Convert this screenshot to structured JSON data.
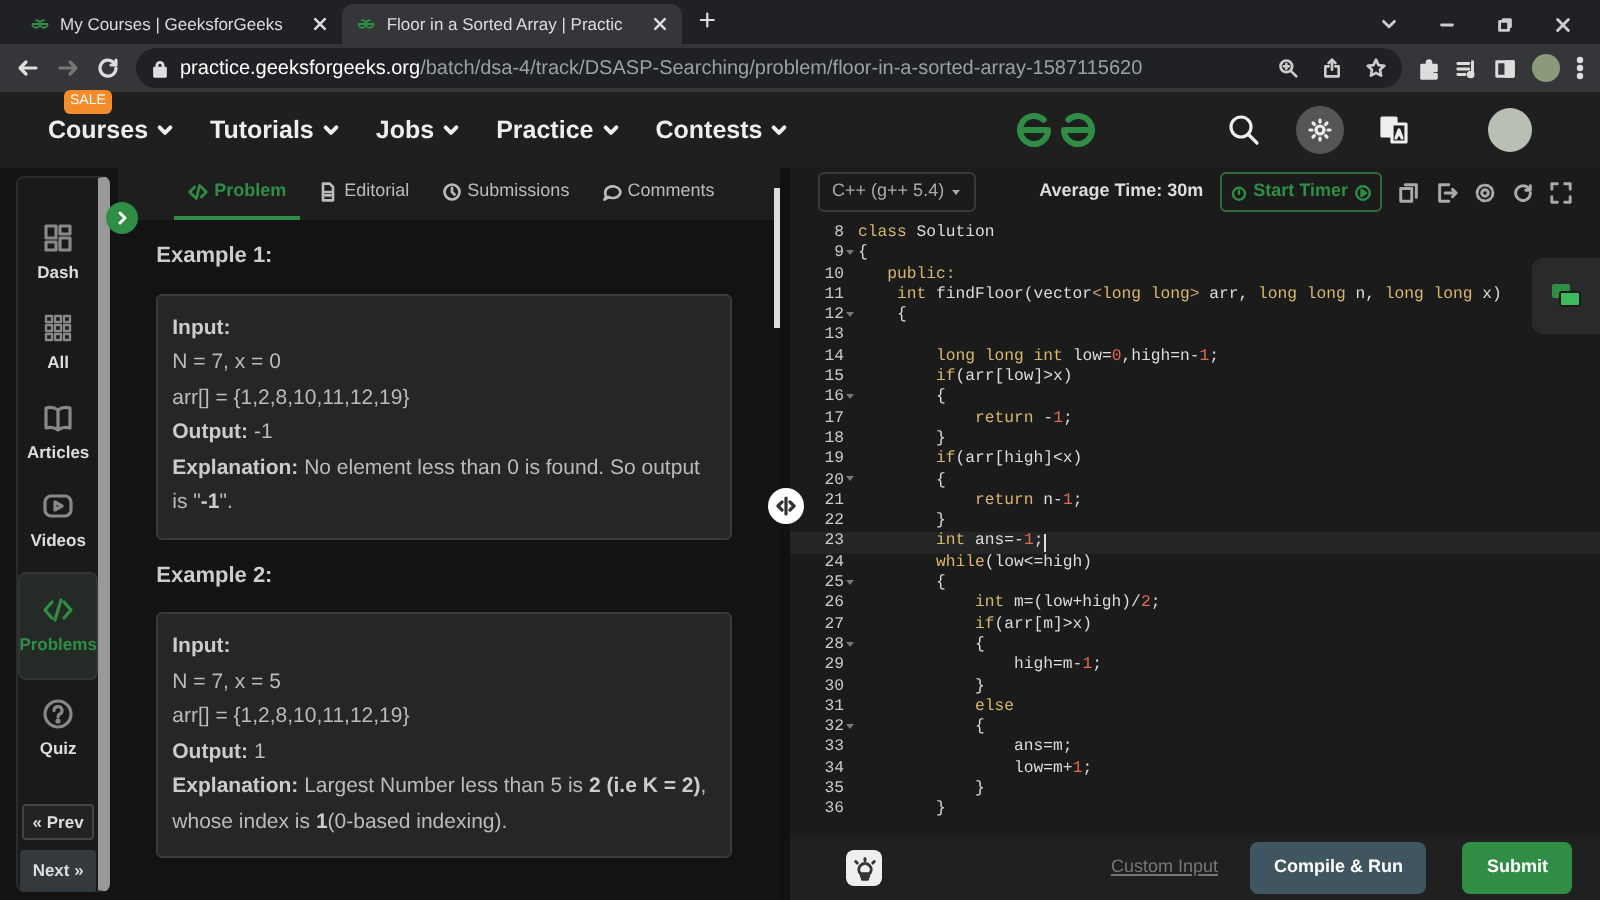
{
  "browser": {
    "tabs": [
      {
        "title": "My Courses | GeeksforGeeks",
        "selected": false
      },
      {
        "title": "Floor in a Sorted Array | Practic",
        "selected": true
      }
    ],
    "new_tab": "+",
    "forward_disabled": true,
    "address": {
      "host": "practice.geeksforgeeks.org",
      "path": "/batch/dsa-4/track/DSASP-Searching/problem/floor-in-a-sorted-array-1587115620"
    }
  },
  "site_nav": {
    "items": [
      {
        "label": "Courses",
        "badge": "SALE"
      },
      {
        "label": "Tutorials"
      },
      {
        "label": "Jobs"
      },
      {
        "label": "Practice"
      },
      {
        "label": "Contests"
      }
    ]
  },
  "sidebar": {
    "items": [
      {
        "label": "Dash",
        "kind": "dash",
        "selected": false
      },
      {
        "label": "All",
        "kind": "all",
        "selected": false
      },
      {
        "label": "Articles",
        "kind": "articles",
        "selected": false
      },
      {
        "label": "Videos",
        "kind": "videos",
        "selected": false
      },
      {
        "label": "Problems",
        "kind": "problems",
        "selected": true
      },
      {
        "label": "Quiz",
        "kind": "quiz",
        "selected": false
      }
    ],
    "prev": "« Prev",
    "next": "Next »"
  },
  "problem_tabs": [
    {
      "label": "Problem",
      "kind": "code",
      "selected": true
    },
    {
      "label": "Editorial",
      "kind": "doc",
      "selected": false
    },
    {
      "label": "Submissions",
      "kind": "clock",
      "selected": false
    },
    {
      "label": "Comments",
      "kind": "chat",
      "selected": false
    }
  ],
  "examples": [
    {
      "title": "Example 1:",
      "input_label": "Input:",
      "input_lines": [
        "N = 7, x = 0",
        "arr[] = {1,2,8,10,11,12,19}"
      ],
      "output_label": "Output:",
      "output": "-1",
      "explanation_label": "Explanation:",
      "explanation": "No element less than 0 is found. So output is \"**-1**\"."
    },
    {
      "title": "Example 2:",
      "input_label": "Input:",
      "input_lines": [
        "N = 7, x = 5",
        "arr[] = {1,2,8,10,11,12,19}"
      ],
      "output_label": "Output:",
      "output": "1",
      "explanation_label": "Explanation:",
      "explanation": "Largest Number less than 5 is **2 (i.e K = 2)**, whose index is **1**(0-based indexing)."
    }
  ],
  "editor": {
    "language": "C++ (g++ 5.4)",
    "average_time": "Average Time: 30m",
    "timer_button": "Start Timer",
    "lines": [
      {
        "no": "8",
        "code": [
          {
            "kind": "keyword",
            "text": "class"
          },
          {
            "kind": "plain",
            "text": " Solution"
          }
        ]
      },
      {
        "no": "9",
        "fold": true,
        "code": [
          {
            "kind": "plain",
            "text": "{"
          }
        ]
      },
      {
        "no": "10",
        "code": [
          {
            "kind": "keyword",
            "text": "   public:"
          }
        ]
      },
      {
        "no": "11",
        "code": [
          {
            "kind": "keyword",
            "text": "    int"
          },
          {
            "kind": "plain",
            "text": " findFloor(vector"
          },
          {
            "kind": "operator",
            "text": "<"
          },
          {
            "kind": "keyword",
            "text": "long long"
          },
          {
            "kind": "operator",
            "text": ">"
          },
          {
            "kind": "plain",
            "text": " arr, "
          },
          {
            "kind": "keyword",
            "text": "long long"
          },
          {
            "kind": "plain",
            "text": " n, "
          },
          {
            "kind": "keyword",
            "text": "long long"
          },
          {
            "kind": "plain",
            "text": " x)"
          }
        ]
      },
      {
        "no": "12",
        "fold": true,
        "code": [
          {
            "kind": "plain",
            "text": "    {"
          }
        ]
      },
      {
        "no": "13"
      },
      {
        "no": "14",
        "code": [
          {
            "kind": "keyword",
            "text": "        long long int"
          },
          {
            "kind": "plain",
            "text": " low="
          },
          {
            "kind": "number",
            "text": "0"
          },
          {
            "kind": "plain",
            "text": ",high=n-"
          },
          {
            "kind": "number",
            "text": "1"
          },
          {
            "kind": "plain",
            "text": ";"
          }
        ]
      },
      {
        "no": "15",
        "code": [
          {
            "kind": "keyword",
            "text": "        if"
          },
          {
            "kind": "plain",
            "text": "(arr[low]>x)"
          }
        ]
      },
      {
        "no": "16",
        "fold": true,
        "code": [
          {
            "kind": "plain",
            "text": "        {"
          }
        ]
      },
      {
        "no": "17",
        "code": [
          {
            "kind": "keyword",
            "text": "            return"
          },
          {
            "kind": "plain",
            "text": " -"
          },
          {
            "kind": "number",
            "text": "1"
          },
          {
            "kind": "plain",
            "text": ";"
          }
        ]
      },
      {
        "no": "18",
        "code": [
          {
            "kind": "plain",
            "text": "        }"
          }
        ]
      },
      {
        "no": "19",
        "code": [
          {
            "kind": "keyword",
            "text": "        if"
          },
          {
            "kind": "plain",
            "text": "(arr[high]<x)"
          }
        ]
      },
      {
        "no": "20",
        "fold": true,
        "code": [
          {
            "kind": "plain",
            "text": "        {"
          }
        ]
      },
      {
        "no": "21",
        "code": [
          {
            "kind": "keyword",
            "text": "            return"
          },
          {
            "kind": "plain",
            "text": " n-"
          },
          {
            "kind": "number",
            "text": "1"
          },
          {
            "kind": "plain",
            "text": ";"
          }
        ]
      },
      {
        "no": "22",
        "code": [
          {
            "kind": "plain",
            "text": "        }"
          }
        ]
      },
      {
        "no": "23",
        "current": true,
        "code": [
          {
            "kind": "keyword",
            "text": "        int"
          },
          {
            "kind": "plain",
            "text": " ans=-"
          },
          {
            "kind": "number",
            "text": "1"
          },
          {
            "kind": "plain",
            "text": ";"
          }
        ]
      },
      {
        "no": "24",
        "code": [
          {
            "kind": "keyword",
            "text": "        while"
          },
          {
            "kind": "plain",
            "text": "(low<=high)"
          }
        ]
      },
      {
        "no": "25",
        "fold": true,
        "code": [
          {
            "kind": "plain",
            "text": "        {"
          }
        ]
      },
      {
        "no": "26",
        "code": [
          {
            "kind": "keyword",
            "text": "            int"
          },
          {
            "kind": "plain",
            "text": " m=(low+high)/"
          },
          {
            "kind": "number",
            "text": "2"
          },
          {
            "kind": "plain",
            "text": ";"
          }
        ]
      },
      {
        "no": "27",
        "code": [
          {
            "kind": "keyword",
            "text": "            if"
          },
          {
            "kind": "plain",
            "text": "(arr[m]>x)"
          }
        ]
      },
      {
        "no": "28",
        "fold": true,
        "code": [
          {
            "kind": "plain",
            "text": "            {"
          }
        ]
      },
      {
        "no": "29",
        "code": [
          {
            "kind": "plain",
            "text": "                high=m-"
          },
          {
            "kind": "number",
            "text": "1"
          },
          {
            "kind": "plain",
            "text": ";"
          }
        ]
      },
      {
        "no": "30",
        "code": [
          {
            "kind": "plain",
            "text": "            }"
          }
        ]
      },
      {
        "no": "31",
        "code": [
          {
            "kind": "keyword",
            "text": "            else"
          }
        ]
      },
      {
        "no": "32",
        "fold": true,
        "code": [
          {
            "kind": "plain",
            "text": "            {"
          }
        ]
      },
      {
        "no": "33",
        "code": [
          {
            "kind": "plain",
            "text": "                ans=m;"
          }
        ]
      },
      {
        "no": "34",
        "code": [
          {
            "kind": "plain",
            "text": "                low=m+"
          },
          {
            "kind": "number",
            "text": "1"
          },
          {
            "kind": "plain",
            "text": ";"
          }
        ]
      },
      {
        "no": "35",
        "code": [
          {
            "kind": "plain",
            "text": "            }"
          }
        ]
      },
      {
        "no": "36",
        "code": [
          {
            "kind": "plain",
            "text": "        }"
          }
        ]
      }
    ],
    "custom_input": "Custom Input",
    "compile_button": "Compile & Run",
    "submit_button": "Submit"
  }
}
